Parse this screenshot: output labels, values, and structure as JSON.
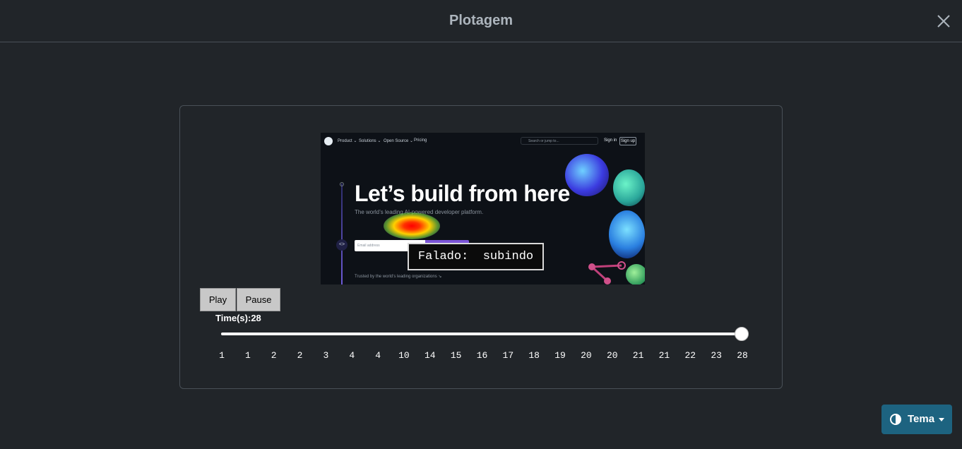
{
  "modal": {
    "title": "Plotagem",
    "close_icon": "close-icon"
  },
  "screenshot": {
    "nav": {
      "items": [
        "Product ⌄",
        "Solutions ⌄",
        "Open Source ⌄",
        "Pricing"
      ],
      "search_placeholder": "Search or jump to...",
      "sign_in": "Sign in",
      "sign_up": "Sign up"
    },
    "headline": "Let’s build from here",
    "subheadline": "The world’s leading AI-powered developer platform.",
    "email_placeholder": "Email address",
    "trusted": "Trusted by the world’s leading organizations ↘"
  },
  "speech_caption": "Falado:  subindo",
  "controls": {
    "play_label": "Play",
    "pause_label": "Pause",
    "time_label": "Time(s):28",
    "current_time": 28,
    "slider_fraction": 1.0
  },
  "timeline_ticks": [
    "1",
    "1",
    "2",
    "2",
    "3",
    "4",
    "4",
    "10",
    "14",
    "15",
    "16",
    "17",
    "18",
    "19",
    "20",
    "20",
    "21",
    "21",
    "22",
    "23",
    "28"
  ],
  "theme": {
    "label": "Tema",
    "icon": "contrast-icon",
    "accent": "#1d6380"
  },
  "colors": {
    "background": "#212529",
    "title": "#adb5bd",
    "border": "#495057"
  }
}
